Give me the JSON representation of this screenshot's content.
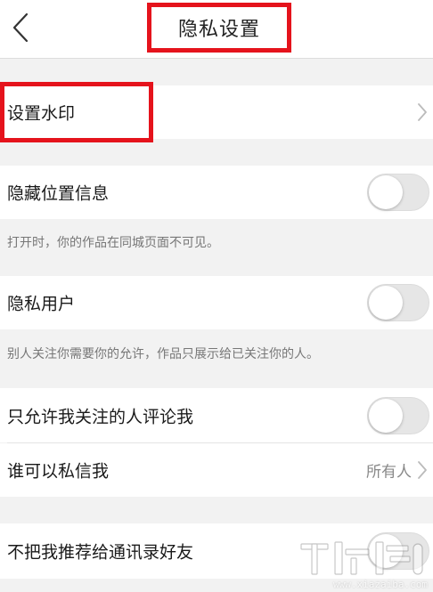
{
  "header": {
    "title": "隐私设置"
  },
  "rows": {
    "watermark": {
      "label": "设置水印"
    },
    "hide_location": {
      "label": "隐藏位置信息",
      "enabled": false
    },
    "private_user": {
      "label": "隐私用户",
      "enabled": false
    },
    "comment_limit": {
      "label": "只允许我关注的人评论我",
      "enabled": false
    },
    "who_can_message": {
      "label": "谁可以私信我",
      "value": "所有人"
    },
    "no_contact_recommend": {
      "label": "不把我推荐给通讯录好友",
      "enabled": false
    }
  },
  "notes": {
    "hide_location_note": "打开时，你的作品在同城页面不可见。",
    "private_user_note": "别人关注你需要你的允许，作品只展示给已关注你的人。"
  },
  "watermark_overlay": {
    "text": "www.xiazaiba.com"
  },
  "colors": {
    "highlight": "#e5131c",
    "background": "#f2f2f2",
    "toggle_off": "#e6e6e6"
  }
}
